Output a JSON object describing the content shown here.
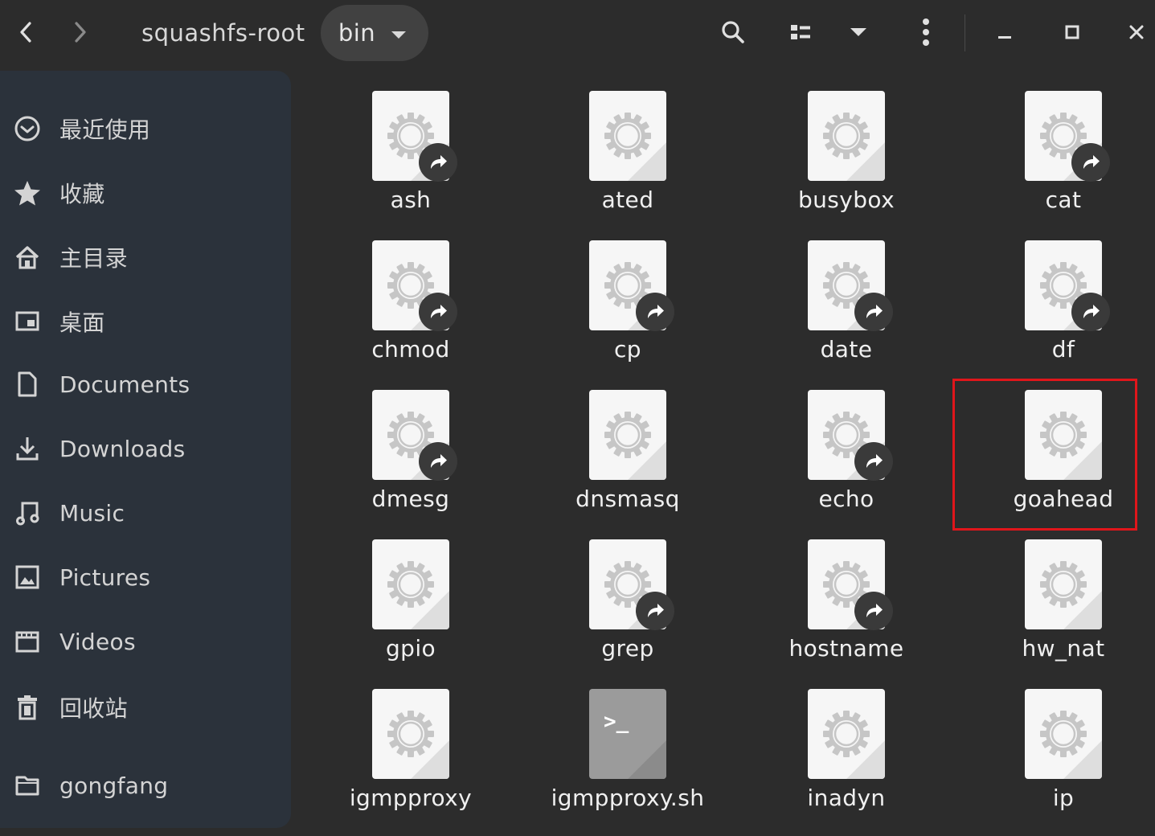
{
  "window": {
    "breadcrumb_root": "squashfs-root",
    "breadcrumb_current": "bin"
  },
  "toolbar": {
    "icons": [
      "back-icon",
      "forward-icon",
      "search-icon",
      "list-view-icon",
      "view-options-icon",
      "kebab-menu-icon",
      "minimize-icon",
      "maximize-icon",
      "close-icon"
    ]
  },
  "sidebar": {
    "items": [
      {
        "label": "最近使用",
        "icon": "recent-icon"
      },
      {
        "label": "收藏",
        "icon": "star-icon"
      },
      {
        "label": "主目录",
        "icon": "home-icon"
      },
      {
        "label": "桌面",
        "icon": "desktop-icon"
      },
      {
        "label": "Documents",
        "icon": "document-icon"
      },
      {
        "label": "Downloads",
        "icon": "download-icon"
      },
      {
        "label": "Music",
        "icon": "music-icon"
      },
      {
        "label": "Pictures",
        "icon": "picture-icon"
      },
      {
        "label": "Videos",
        "icon": "video-icon"
      },
      {
        "label": "回收站",
        "icon": "trash-icon"
      },
      {
        "label": "gongfang",
        "icon": "folder-icon"
      }
    ]
  },
  "files": [
    {
      "name": "ash",
      "type": "executable",
      "link": true
    },
    {
      "name": "ated",
      "type": "executable",
      "link": false
    },
    {
      "name": "busybox",
      "type": "executable",
      "link": false
    },
    {
      "name": "cat",
      "type": "executable",
      "link": true
    },
    {
      "name": "chmod",
      "type": "executable",
      "link": true
    },
    {
      "name": "cp",
      "type": "executable",
      "link": true
    },
    {
      "name": "date",
      "type": "executable",
      "link": true
    },
    {
      "name": "df",
      "type": "executable",
      "link": true
    },
    {
      "name": "dmesg",
      "type": "executable",
      "link": true
    },
    {
      "name": "dnsmasq",
      "type": "executable",
      "link": false
    },
    {
      "name": "echo",
      "type": "executable",
      "link": true
    },
    {
      "name": "goahead",
      "type": "executable",
      "link": false,
      "highlighted": true
    },
    {
      "name": "gpio",
      "type": "executable",
      "link": false
    },
    {
      "name": "grep",
      "type": "executable",
      "link": true
    },
    {
      "name": "hostname",
      "type": "executable",
      "link": true
    },
    {
      "name": "hw_nat",
      "type": "executable",
      "link": false
    },
    {
      "name": "igmpproxy",
      "type": "executable",
      "link": false
    },
    {
      "name": "igmpproxy.sh",
      "type": "script",
      "link": false,
      "prompt": ">_"
    },
    {
      "name": "inadyn",
      "type": "executable",
      "link": false
    },
    {
      "name": "ip",
      "type": "executable",
      "link": false
    }
  ],
  "colors": {
    "background": "#2c2c2c",
    "sidebar": "#2b323b",
    "highlight_border": "#e0161b",
    "file_icon": "#f6f6f6"
  }
}
